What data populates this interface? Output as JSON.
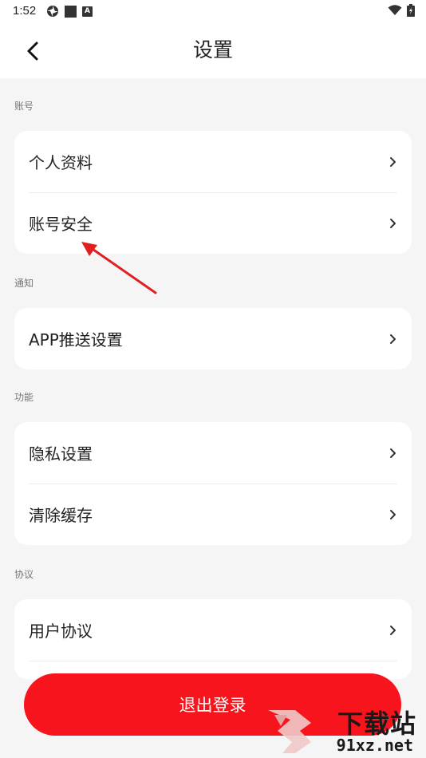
{
  "status_bar": {
    "time": "1:52"
  },
  "header": {
    "title": "设置"
  },
  "sections": [
    {
      "label": "账号",
      "items": [
        {
          "label": "个人资料"
        },
        {
          "label": "账号安全"
        }
      ]
    },
    {
      "label": "通知",
      "items": [
        {
          "label": "APP推送设置"
        }
      ]
    },
    {
      "label": "功能",
      "items": [
        {
          "label": "隐私设置"
        },
        {
          "label": "清除缓存"
        }
      ]
    },
    {
      "label": "协议",
      "items": [
        {
          "label": "用户协议"
        }
      ]
    }
  ],
  "logout": {
    "label": "退出登录"
  },
  "watermark": {
    "text": "下载站",
    "domain": "91xz.net"
  },
  "colors": {
    "accent": "#f7141c",
    "background": "#f5f5f5",
    "card": "#ffffff"
  }
}
